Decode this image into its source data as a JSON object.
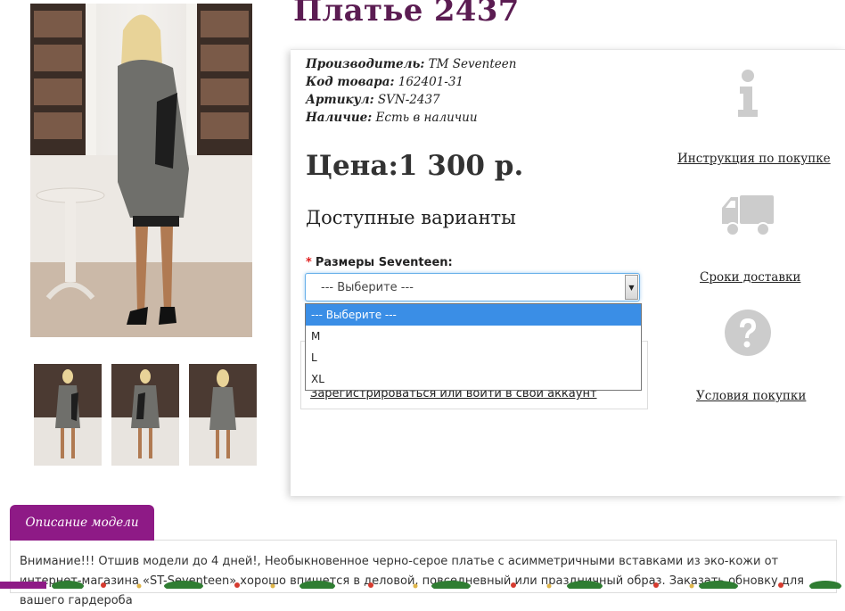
{
  "product": {
    "title": "Платье 2437",
    "manufacturer_label": "Производитель:",
    "manufacturer_value": "TM Seventeen",
    "code_label": "Код товара:",
    "code_value": "162401-31",
    "article_label": "Артикул:",
    "article_value": "SVN-2437",
    "availability_label": "Наличие:",
    "availability_value": "Есть в наличии",
    "price": "Цена:1 300 р.",
    "variants_title": "Доступные варианты"
  },
  "options": {
    "size_label": "Размеры Seventeen:",
    "required_mark": "*",
    "selected": "--- Выберите ---",
    "list": [
      "--- Выберите ---",
      "M",
      "L",
      "XL"
    ]
  },
  "account": {
    "login_link": "Зарегистрироваться или войти в свой аккаунт"
  },
  "sidebar": {
    "instruction_link": "Инструкция по покупке",
    "delivery_link": "Сроки доставки",
    "terms_link": "Условия покупки",
    "icons": [
      "info-icon",
      "truck-icon",
      "question-icon"
    ]
  },
  "description": {
    "tab_label": "Описание модели",
    "text": "Внимание!!! Отшив модели до 4 дней!, Необыкновенное черно-серое платье с асимметричными вставками из эко-кожи от интернет-магазина «ST-Seventeen» хорошо впишется в деловой, повседневный или праздничный образ. Заказать обновку для вашего гардероба"
  },
  "colors": {
    "title": "#5b1c52",
    "accent": "#8e1a86",
    "select_highlight": "#3a8ee6",
    "icon_gray": "#cccccc"
  }
}
